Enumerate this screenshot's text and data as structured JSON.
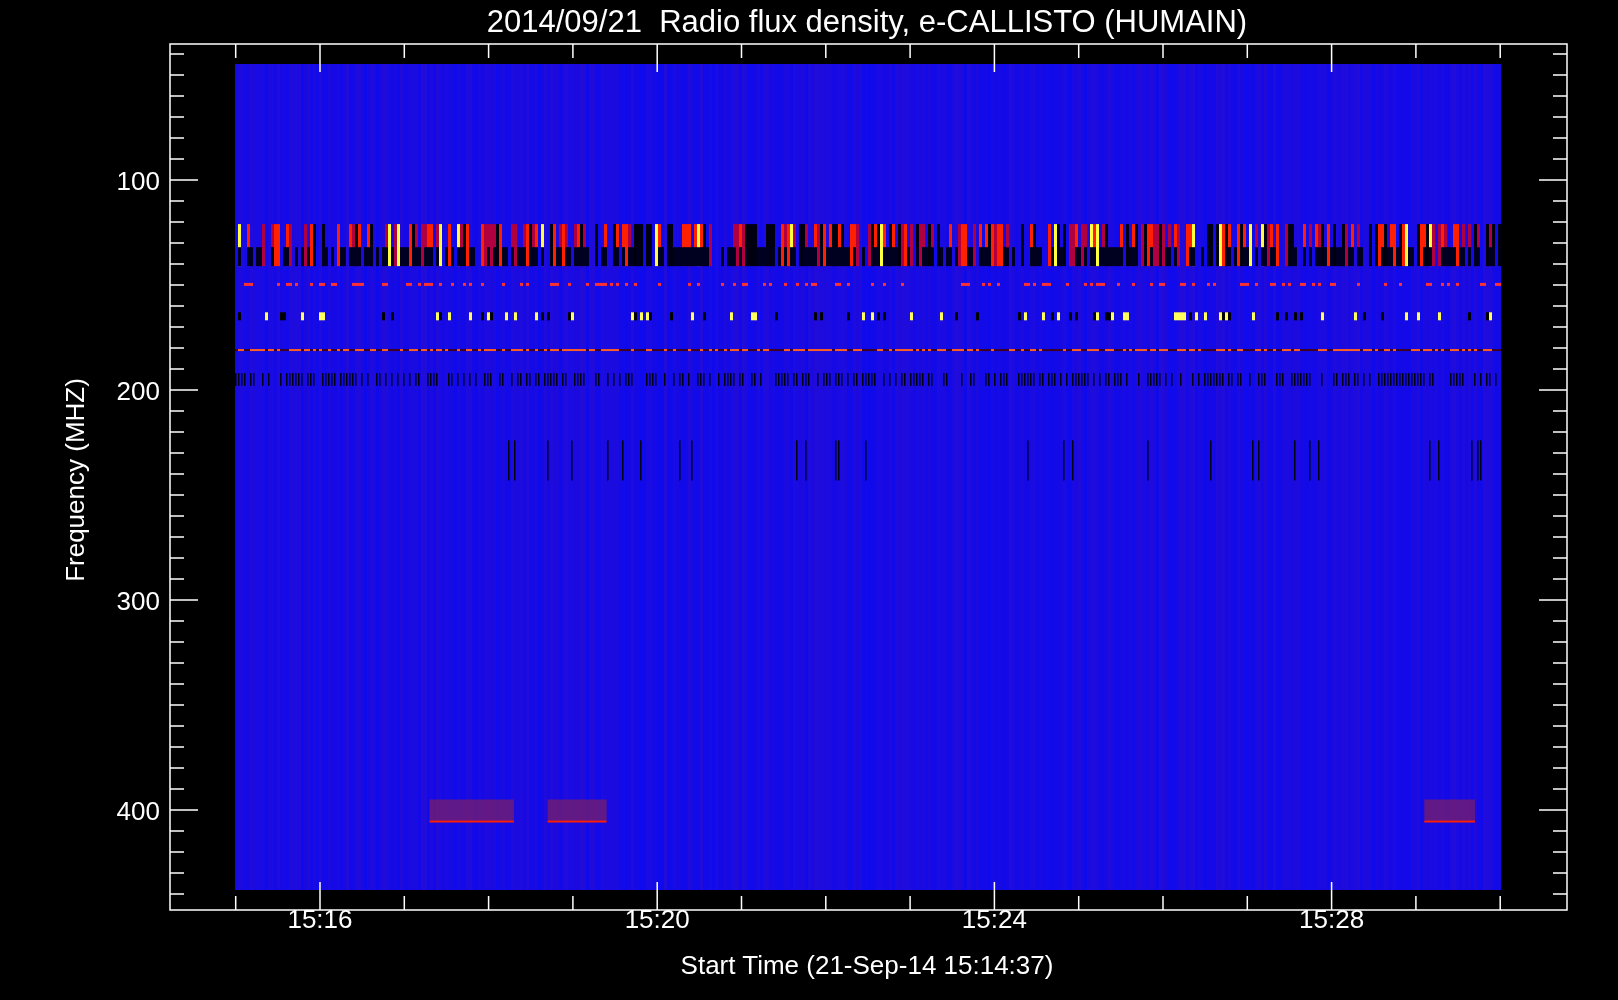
{
  "title": "2014/09/21  Radio flux density, e-CALLISTO (HUMAIN)",
  "y_axis": {
    "label": "Frequency (MHZ)",
    "ticks": [
      "100",
      "200",
      "300",
      "400"
    ]
  },
  "x_axis": {
    "label": "Start Time (21-Sep-14 15:14:37)",
    "ticks": [
      "15:16",
      "15:20",
      "15:24",
      "15:28"
    ]
  }
}
